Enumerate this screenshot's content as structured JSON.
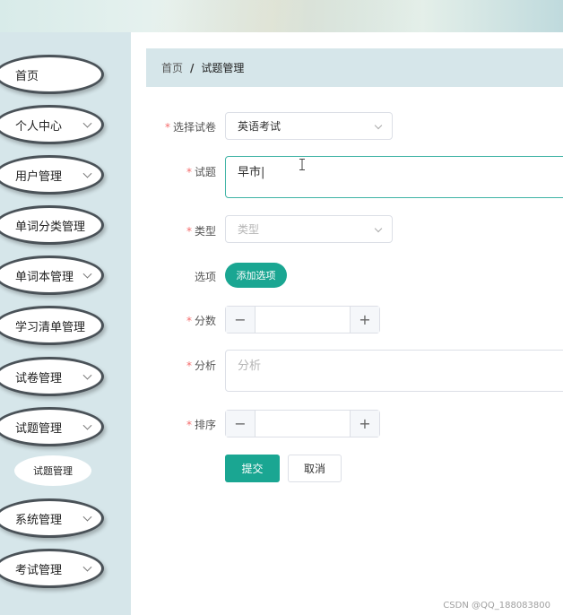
{
  "sidebar": {
    "items": [
      {
        "label": "首页",
        "expandable": false
      },
      {
        "label": "个人中心",
        "expandable": true
      },
      {
        "label": "用户管理",
        "expandable": true
      },
      {
        "label": "单词分类管理",
        "expandable": false
      },
      {
        "label": "单词本管理",
        "expandable": true
      },
      {
        "label": "学习清单管理",
        "expandable": false
      },
      {
        "label": "试卷管理",
        "expandable": true
      },
      {
        "label": "试题管理",
        "expandable": true
      },
      {
        "label": "系统管理",
        "expandable": true
      },
      {
        "label": "考试管理",
        "expandable": true
      }
    ],
    "sub_item": "试题管理"
  },
  "breadcrumb": {
    "home": "首页",
    "separator": "/",
    "current": "试题管理"
  },
  "form": {
    "paper": {
      "label": "选择试卷",
      "value": "英语考试"
    },
    "question": {
      "label": "试题",
      "value": "早市|"
    },
    "type": {
      "label": "类型",
      "placeholder": "类型"
    },
    "options": {
      "label": "选项",
      "button": "添加选项"
    },
    "score": {
      "label": "分数",
      "minus": "−",
      "plus": "+"
    },
    "analysis": {
      "label": "分析",
      "placeholder": "分析"
    },
    "order": {
      "label": "排序",
      "minus": "−",
      "plus": "+"
    },
    "required_mark": "*",
    "submit": "提交",
    "cancel": "取消"
  },
  "watermark": "CSDN @QQ_188083800",
  "colors": {
    "accent": "#1aa692",
    "sidebar_bg": "#d6e6ea",
    "required": "#f56c6c"
  }
}
